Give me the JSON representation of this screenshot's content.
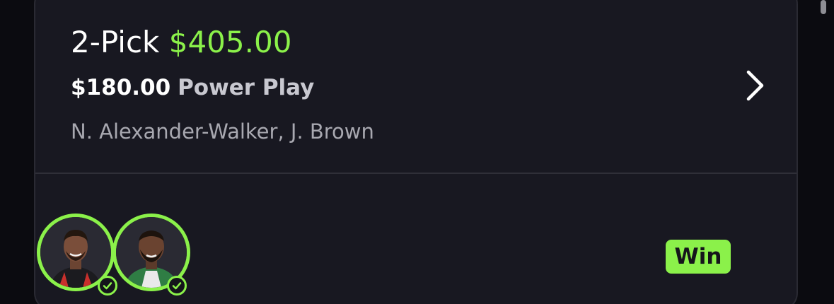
{
  "entry": {
    "pick_count": "2-Pick",
    "payout": "$405.00",
    "stake": "$180.00",
    "play_type": "Power Play",
    "players": "N. Alexander-Walker, J. Brown",
    "result": "Win"
  },
  "avatars": [
    {
      "jersey": "red-black"
    },
    {
      "jersey": "green-white"
    }
  ],
  "colors": {
    "accent": "#8bf14a",
    "card_bg": "#181821",
    "page_bg": "#0b0b10",
    "text_muted": "#a8a8b0"
  }
}
